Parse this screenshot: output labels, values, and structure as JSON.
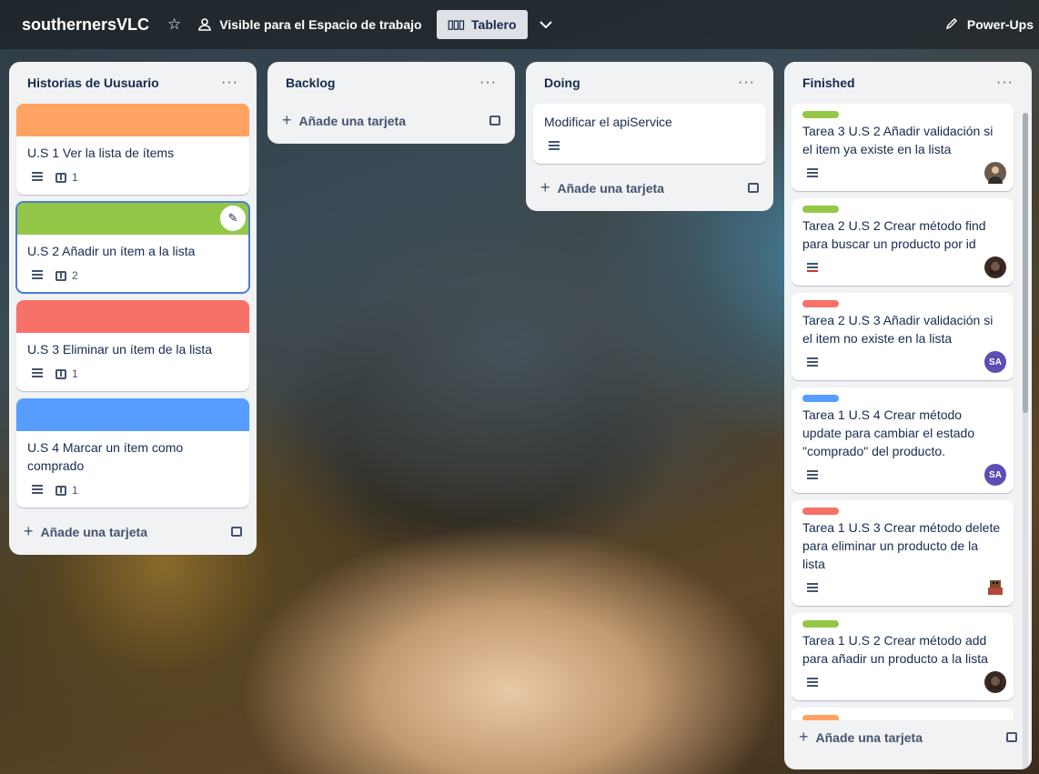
{
  "topbar": {
    "board_title": "southernersVLC",
    "visibility": "Visible para el Espacio de trabajo",
    "view": "Tablero",
    "powerups": "Power-Ups"
  },
  "add_card_label": "Añade una tarjeta",
  "lists": [
    {
      "title": "Historias de Uusuario",
      "cards": [
        {
          "title": "U.S 1 Ver la lista de ítems",
          "cover": "#fea362",
          "checklist": "1"
        },
        {
          "title": "U.S 2 Añadir un ítem a la lista",
          "cover": "#94c748",
          "checklist": "2"
        },
        {
          "title": "U.S 3 Eliminar un ítem de la lista",
          "cover": "#f87168",
          "checklist": "1"
        },
        {
          "title": "U.S 4 Marcar un ítem como comprado",
          "cover": "#579dff",
          "checklist": "1"
        }
      ]
    },
    {
      "title": "Backlog",
      "cards": []
    },
    {
      "title": "Doing",
      "cards": [
        {
          "title": "Modificar el apiService"
        }
      ]
    },
    {
      "title": "Finished",
      "cards": [
        {
          "title": "Tarea 3 U.S 2 Añadir validación si el item ya existe en la lista",
          "label": "#94c748",
          "avatar": "photo-man"
        },
        {
          "title": "Tarea 2 U.S 2 Crear método find para buscar un producto por id",
          "label": "#94c748",
          "avatar": "photo-woman"
        },
        {
          "title": "Tarea 2 U.S 3 Añadir validación si el item no existe en la lista",
          "label": "#f87168",
          "avatar_initials": "SA"
        },
        {
          "title": "Tarea 1 U.S 4 Crear método update para cambiar el estado \"comprado\" del producto.",
          "label": "#579dff",
          "avatar_initials": "SA"
        },
        {
          "title": "Tarea 1 U.S 3 Crear método delete para eliminar un producto de la lista",
          "label": "#f87168",
          "avatar": "photo-pixel"
        },
        {
          "title": "Tarea 1 U.S 2 Crear método add para añadir un producto a la lista",
          "label": "#94c748",
          "avatar": "photo-woman"
        },
        {
          "title": "",
          "label": "#fea362"
        }
      ]
    }
  ],
  "colors": {
    "avatar_sa": "#5e4db2"
  }
}
